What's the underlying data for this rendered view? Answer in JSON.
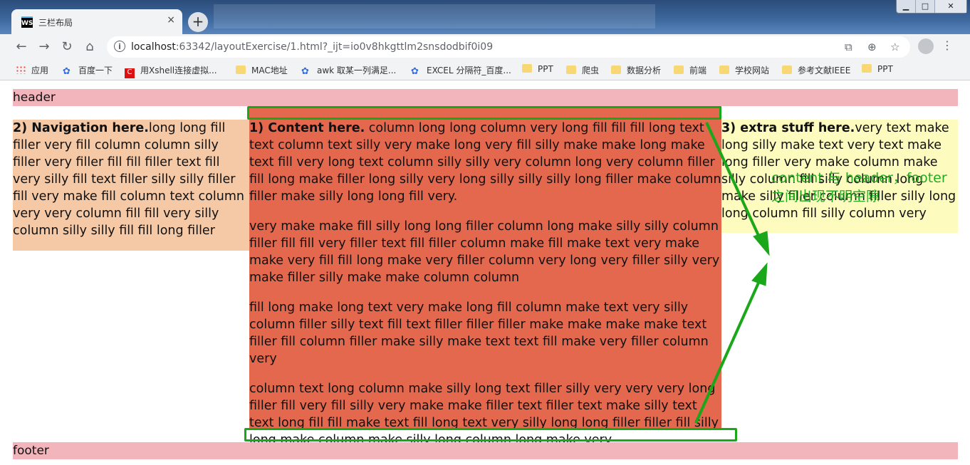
{
  "browser": {
    "tab_title": "三栏布局",
    "tab_logo": "WS",
    "tab_close": "×",
    "new_tab": "+",
    "window_buttons": {
      "minimize": "▁",
      "maximize": "□",
      "close": "✕"
    },
    "url_host": "localhost",
    "url_rest": ":63342/layoutExercise/1.html?_ijt=io0v8hkgttlm2snsdodbif0i09",
    "bookmarks": [
      {
        "label": "应用",
        "icon": "apps-grid-icon"
      },
      {
        "label": "百度一下",
        "icon": "baidu-paw-icon"
      },
      {
        "label": "用Xshell连接虚拟...",
        "icon": "red-c-icon"
      },
      {
        "label": "MAC地址",
        "icon": "folder-icon"
      },
      {
        "label": "awk 取某一列满足...",
        "icon": "baidu-paw-icon"
      },
      {
        "label": "EXCEL 分隔符_百度...",
        "icon": "baidu-paw-icon"
      },
      {
        "label": "PPT",
        "icon": "folder-icon"
      },
      {
        "label": "爬虫",
        "icon": "folder-icon"
      },
      {
        "label": "数据分析",
        "icon": "folder-icon"
      },
      {
        "label": "前端",
        "icon": "folder-icon"
      },
      {
        "label": "学校网站",
        "icon": "folder-icon"
      },
      {
        "label": "参考文献IEEE",
        "icon": "folder-icon"
      },
      {
        "label": "PPT",
        "icon": "folder-icon"
      }
    ]
  },
  "page": {
    "header": "header",
    "footer": "footer",
    "nav_bold": "2) Navigation here.",
    "nav_text": "long long fill filler very fill column column silly filler very filler fill fill filler text fill very silly fill text filler silly silly filler fill very make fill column text column very very column fill fill very silly column silly silly fill fill long filler",
    "content_bold": "1) Content here.",
    "content_p1": " column long long column very long fill fill fill long text text column text silly very make long very fill silly make make long make text fill very long text column silly silly very column long very column filler fill long make filler long silly very long silly silly silly long filler make column filler make silly long long fill very.",
    "content_p2": "very make make fill silly long long filler column long make silly silly column filler fill fill very filler text fill filler column make fill make text very make make very fill fill long make very filler column very long very filler silly very make filler silly make make column column",
    "content_p3": "fill long make long text very make long fill column make text very silly column filler silly text fill text filler filler filler make make make make text filler fill column filler make silly make text text fill make very filler column very",
    "content_p4": "column text long column make silly long text filler silly very very very long filler fill very fill silly very make make filler text filler text make silly text text long fill fill make text fill long text very silly long long filler filler fill silly long make column make silly long column long make very",
    "extra_bold": "3) extra stuff here.",
    "extra_text": "very text make long silly make text very text make long filler very make column make silly column fill silly column long make silly filler column filler silly long long column fill silly column very"
  },
  "annotation": {
    "line1": "content 与 header，footer",
    "line2": "之间出现不明空隙",
    "color": "#22aa22"
  }
}
